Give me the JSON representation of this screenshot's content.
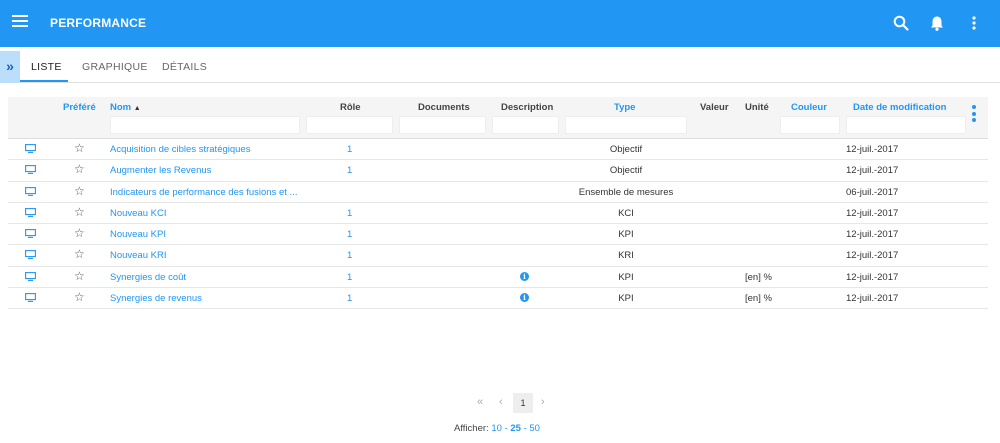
{
  "app": {
    "title": "PERFORMANCE"
  },
  "colors": {
    "primary": "#2196f3",
    "toggle_bg": "#bbdefb"
  },
  "icons": {
    "menu": "menu-icon",
    "search": "search-icon",
    "notifications": "bell-icon",
    "more": "more-vert-icon",
    "sidebar_toggle": "double-chevron-right-icon",
    "row_type": "monitor-icon",
    "favorite": "star-outline-icon",
    "info": "info-icon"
  },
  "sidebar_toggle": {
    "label": "»"
  },
  "tabs": [
    {
      "label": "LISTE",
      "active": true
    },
    {
      "label": "GRAPHIQUE",
      "active": false
    },
    {
      "label": "DÉTAILS",
      "active": false
    }
  ],
  "table": {
    "columns": {
      "prefere": "Préféré",
      "nom": "Nom",
      "sort_indicator": "▲",
      "role": "Rôle",
      "documents": "Documents",
      "description": "Description",
      "type": "Type",
      "valeur": "Valeur",
      "unite": "Unité",
      "couleur": "Couleur",
      "date": "Date de modification"
    },
    "rows": [
      {
        "nom": "Acquisition de cibles stratégiques",
        "role": "1",
        "info": false,
        "type": "Objectif",
        "unite": "",
        "date": "12-juil.-2017"
      },
      {
        "nom": "Augmenter les Revenus",
        "role": "1",
        "info": false,
        "type": "Objectif",
        "unite": "",
        "date": "12-juil.-2017"
      },
      {
        "nom": "Indicateurs de performance des fusions et ...",
        "role": "",
        "info": false,
        "type": "Ensemble de mesures",
        "unite": "",
        "date": "06-juil.-2017"
      },
      {
        "nom": "Nouveau KCI",
        "role": "1",
        "info": false,
        "type": "KCI",
        "unite": "",
        "date": "12-juil.-2017"
      },
      {
        "nom": "Nouveau KPI",
        "role": "1",
        "info": false,
        "type": "KPI",
        "unite": "",
        "date": "12-juil.-2017"
      },
      {
        "nom": "Nouveau KRI",
        "role": "1",
        "info": false,
        "type": "KRI",
        "unite": "",
        "date": "12-juil.-2017"
      },
      {
        "nom": "Synergies de coût",
        "role": "1",
        "info": true,
        "type": "KPI",
        "unite": "[en] %",
        "date": "12-juil.-2017"
      },
      {
        "nom": "Synergies de revenus",
        "role": "1",
        "info": true,
        "type": "KPI",
        "unite": "[en] %",
        "date": "12-juil.-2017"
      }
    ]
  },
  "pagination": {
    "first": "«",
    "prev": "‹",
    "current": "1",
    "next": "›"
  },
  "page_size": {
    "label": "Afficher:",
    "options": [
      "10",
      "25",
      "50"
    ],
    "separator": "-",
    "selected": "25"
  }
}
